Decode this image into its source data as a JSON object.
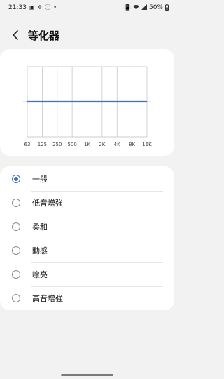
{
  "status_bar": {
    "time": "21:33",
    "battery": "50%",
    "left_icons": [
      "gallery-icon",
      "pinwheel-icon",
      "info-icon",
      "dot-icon"
    ],
    "right_icons": [
      "vibrate-icon",
      "wifi-icon",
      "signal-icon",
      "battery-icon"
    ]
  },
  "header": {
    "title": "等化器"
  },
  "equalizer": {
    "bands": [
      "63",
      "125",
      "250",
      "500",
      "1K",
      "2K",
      "4K",
      "8K",
      "16K"
    ],
    "levels": [
      0,
      0,
      0,
      0,
      0,
      0,
      0,
      0,
      0
    ],
    "line_color": "#3b6fd1"
  },
  "presets": {
    "selected_index": 0,
    "options": [
      {
        "label": "一般"
      },
      {
        "label": "低音增強"
      },
      {
        "label": "柔和"
      },
      {
        "label": "動感"
      },
      {
        "label": "嘹亮"
      },
      {
        "label": "高音增強"
      }
    ]
  },
  "colors": {
    "accent": "#3b6fd1",
    "background": "#f2f2f2",
    "card": "#ffffff"
  }
}
